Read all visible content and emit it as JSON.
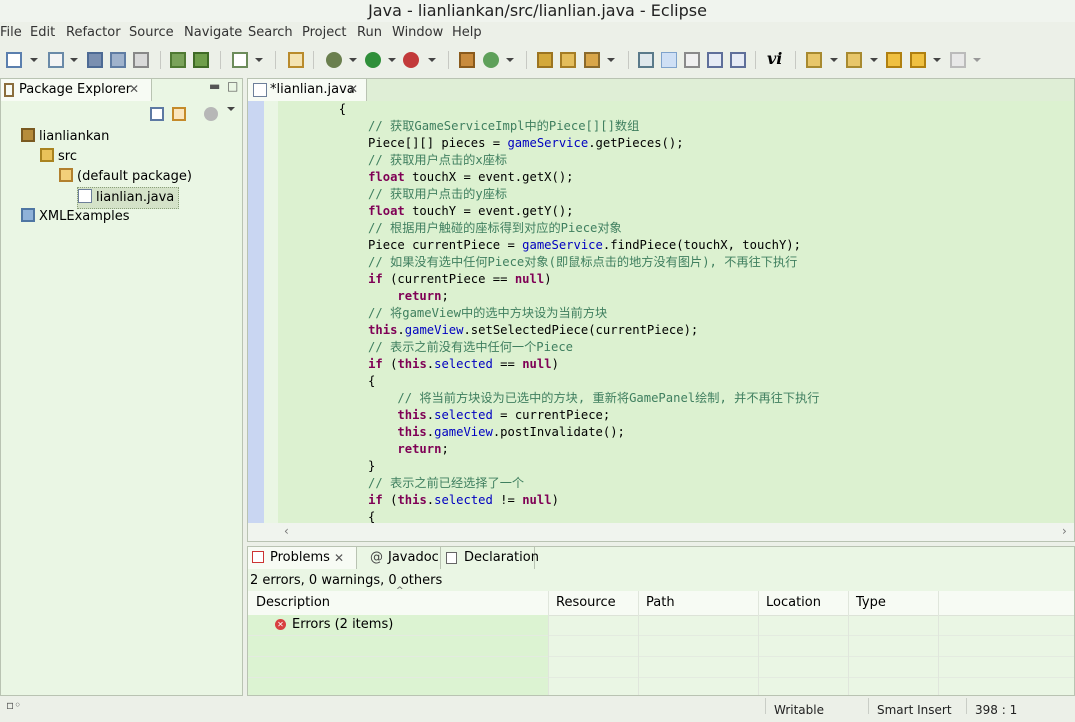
{
  "window": {
    "title": "Java - lianliankan/src/lianlian.java - Eclipse"
  },
  "menu": [
    "File",
    "Edit",
    "Refactor",
    "Source",
    "Navigate",
    "Search",
    "Project",
    "Run",
    "Window",
    "Help"
  ],
  "package_explorer": {
    "tab_label": "Package Explorer",
    "tree": [
      {
        "label": "lianliankan",
        "icon": "project-icon"
      },
      {
        "label": "src",
        "icon": "source-folder-icon"
      },
      {
        "label": "(default package)",
        "icon": "package-icon"
      },
      {
        "label": "lianlian.java",
        "icon": "java-file-icon"
      },
      {
        "label": "XMLExamples",
        "icon": "project-icon"
      }
    ]
  },
  "editor": {
    "tab_label": "*lianlian.java",
    "lines": [
      "        {",
      "            // 获取GameServiceImpl中的Piece[][]数组",
      "            Piece[][] pieces = gameService.getPieces();",
      "            // 获取用户点击的x座标",
      "            float touchX = event.getX();",
      "            // 获取用户点击的y座标",
      "            float touchY = event.getY();",
      "            // 根据用户触碰的座标得到对应的Piece对象",
      "            Piece currentPiece = gameService.findPiece(touchX, touchY);",
      "            // 如果没有选中任何Piece对象(即鼠标点击的地方没有图片), 不再往下执行",
      "            if (currentPiece == null)",
      "                return;",
      "            // 将gameView中的选中方块设为当前方块",
      "            this.gameView.setSelectedPiece(currentPiece);",
      "            // 表示之前没有选中任何一个Piece",
      "            if (this.selected == null)",
      "            {",
      "                // 将当前方块设为已选中的方块, 重新将GamePanel绘制, 并不再往下执行",
      "                this.selected = currentPiece;",
      "                this.gameView.postInvalidate();",
      "                return;",
      "            }",
      "            // 表示之前已经选择了一个",
      "            if (this.selected != null)",
      "            {"
    ]
  },
  "problems": {
    "tabs": [
      "Problems",
      "Javadoc",
      "Declaration"
    ],
    "summary": "2 errors, 0 warnings, 0 others",
    "columns": [
      "Description",
      "Resource",
      "Path",
      "Location",
      "Type"
    ],
    "rows": [
      {
        "description": "Errors (2 items)"
      }
    ]
  },
  "status": {
    "writable": "Writable",
    "insert_mode": "Smart Insert",
    "position": "398 : 1"
  }
}
